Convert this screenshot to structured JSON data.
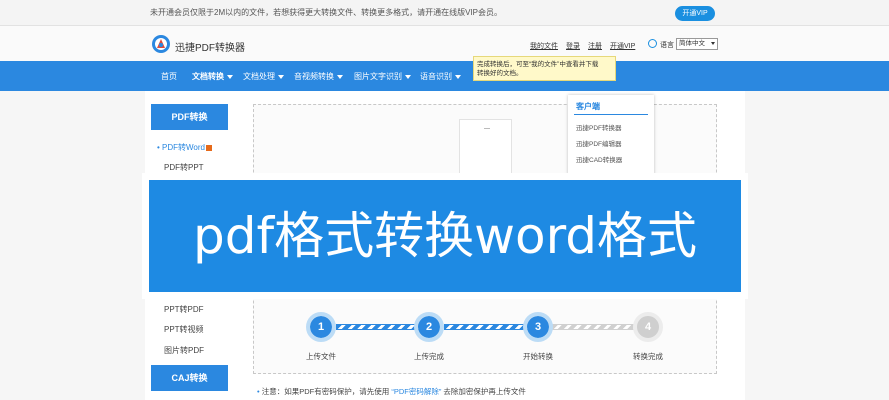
{
  "notice": {
    "text": "未开通会员仅限于2M以内的文件，若想获得更大转换文件、转换更多格式，请开通在线版VIP会员。",
    "vip_button": "开通VIP"
  },
  "header": {
    "app_name": "迅捷PDF转换器",
    "links": [
      "我的文件",
      "登录",
      "注册",
      "开通VIP"
    ],
    "language_label": "语言",
    "language_value": "简体中文"
  },
  "nav": {
    "items": [
      {
        "label": "首页",
        "dropdown": false
      },
      {
        "label": "文档转换",
        "dropdown": true
      },
      {
        "label": "文档处理",
        "dropdown": true
      },
      {
        "label": "音视频转换",
        "dropdown": true
      },
      {
        "label": "图片文字识别",
        "dropdown": true
      },
      {
        "label": "语音识别",
        "dropdown": true
      }
    ]
  },
  "tooltip": {
    "line1": "完成转换后，可至“我的文件”中查看并下载",
    "line2": "转换好的文档。"
  },
  "client_menu": {
    "title": "客户端",
    "items": [
      "迅捷PDF转换器",
      "迅捷PDF编辑器",
      "迅捷CAD转换器"
    ]
  },
  "sidebar": {
    "pdf_header": "PDF转换",
    "top_items": [
      "PDF转Word",
      "PDF转PPT"
    ],
    "bottom_items": [
      "PPT转PDF",
      "PPT转视频",
      "图片转PDF"
    ],
    "caj_header": "CAJ转换"
  },
  "steps": [
    {
      "num": "1",
      "label": "上传文件"
    },
    {
      "num": "2",
      "label": "上传完成"
    },
    {
      "num": "3",
      "label": "开始转换"
    },
    {
      "num": "4",
      "label": "转换完成"
    }
  ],
  "tip": {
    "prefix": "注意：如果PDF有密码保护，请先使用",
    "link": "“PDF密码解除”",
    "suffix": "去除加密保护再上传文件"
  },
  "banner": {
    "text": "pdf格式转换word格式"
  },
  "colors": {
    "brand_blue": "#2b88e0",
    "banner_blue": "#1e8ae3",
    "tooltip_bg": "#fff9c9"
  }
}
